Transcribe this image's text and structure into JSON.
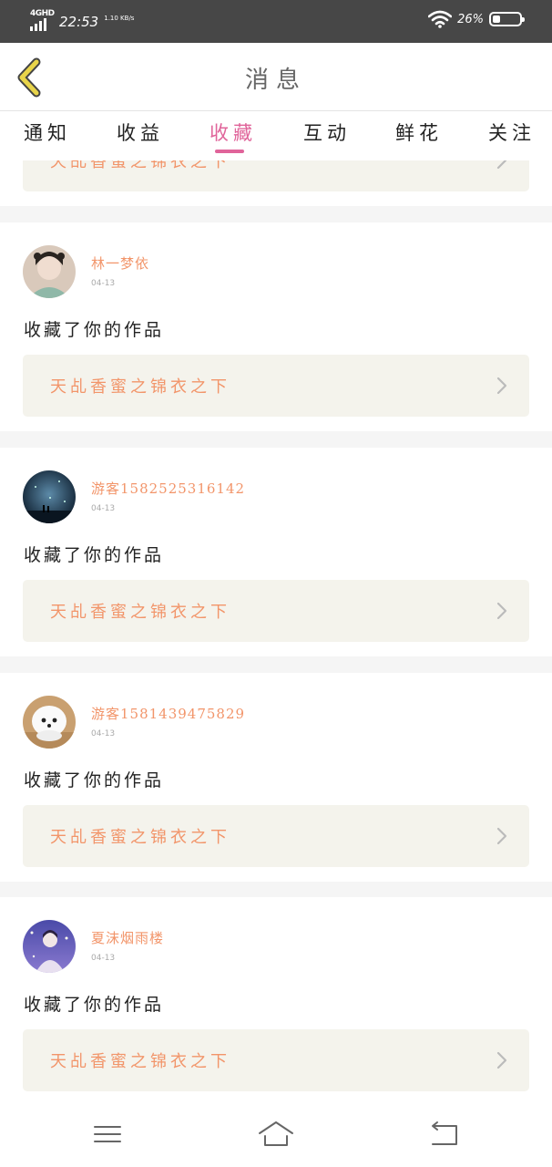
{
  "status_bar": {
    "network": "4GHD",
    "time": "22:53",
    "speed": "1.10 KB/s",
    "battery_text": "26%",
    "battery_level": 0.26,
    "icons": [
      "signal-icon",
      "wifi-icon",
      "battery-icon"
    ]
  },
  "header": {
    "title": "消息",
    "back_icon": "chevron-left-icon"
  },
  "tabs": [
    {
      "label": "通知",
      "active": false
    },
    {
      "label": "收益",
      "active": false
    },
    {
      "label": "收藏",
      "active": true
    },
    {
      "label": "互动",
      "active": false
    },
    {
      "label": "鲜花",
      "active": false
    },
    {
      "label": "关注",
      "active": false
    }
  ],
  "partial_card": {
    "work_title": "天乩香蜜之锦衣之下"
  },
  "messages": [
    {
      "user": "林一梦依",
      "date": "04-13",
      "text": "收藏了你的作品",
      "work_title": "天乩香蜜之锦衣之下"
    },
    {
      "user": "游客1582525316142",
      "date": "04-13",
      "text": "收藏了你的作品",
      "work_title": "天乩香蜜之锦衣之下"
    },
    {
      "user": "游客1581439475829",
      "date": "04-13",
      "text": "收藏了你的作品",
      "work_title": "天乩香蜜之锦衣之下"
    },
    {
      "user": "夏沫烟雨楼",
      "date": "04-13",
      "text": "收藏了你的作品",
      "work_title": "天乩香蜜之锦衣之下"
    }
  ],
  "nav_bar": {
    "icons": [
      "menu-icon",
      "home-icon",
      "back-icon"
    ]
  },
  "colors": {
    "accent": "#e0649a",
    "name": "#f2956a",
    "work_box": "#f4f3ec",
    "status_bar": "#474747",
    "back_arrow": "#e8d44a"
  }
}
